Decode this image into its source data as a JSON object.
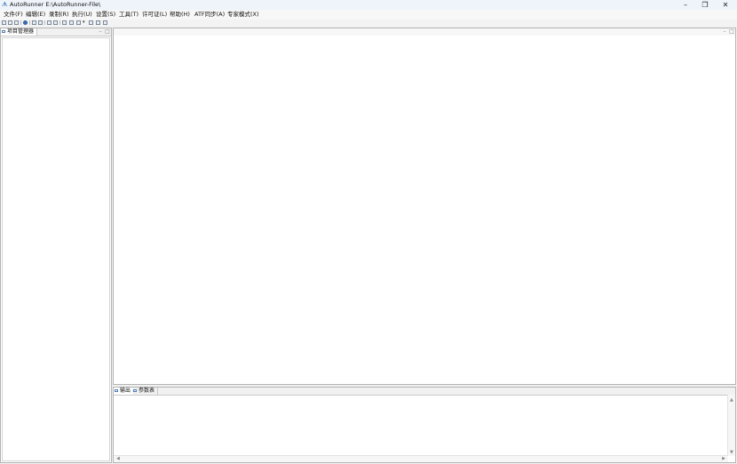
{
  "window": {
    "title": "AutoRunner  E:\\AutoRunner-File\\",
    "minimize_glyph": "–",
    "restore_glyph": "❐",
    "close_glyph": "✕"
  },
  "menu": {
    "items": [
      "文件(F)",
      "编辑(E)",
      "录制(R)",
      "执行(U)",
      "设置(S)",
      "工具(T)",
      "许可证(L)",
      "帮助(H)",
      "ATF同步(A)",
      "专家模式(X)"
    ]
  },
  "toolbar": {
    "icons": [
      "new-icon",
      "open-icon",
      "save-icon",
      "record-icon",
      "run-icon",
      "step-icon",
      "find-icon",
      "replace-icon",
      "text-icon",
      "compare-icon",
      "checkpoint-icon",
      "dropdown-icon",
      "grid-icon",
      "window-icon",
      "report-icon"
    ]
  },
  "left_panel": {
    "tab_label": "项目管理器"
  },
  "bottom_panel": {
    "tabs": [
      "输出",
      "参数表"
    ]
  },
  "panel_controls": {
    "minimize_glyph": "–",
    "maximize_glyph": "□"
  },
  "scroll": {
    "up": "▲",
    "down": "▼",
    "left": "◀",
    "right": "▶"
  }
}
